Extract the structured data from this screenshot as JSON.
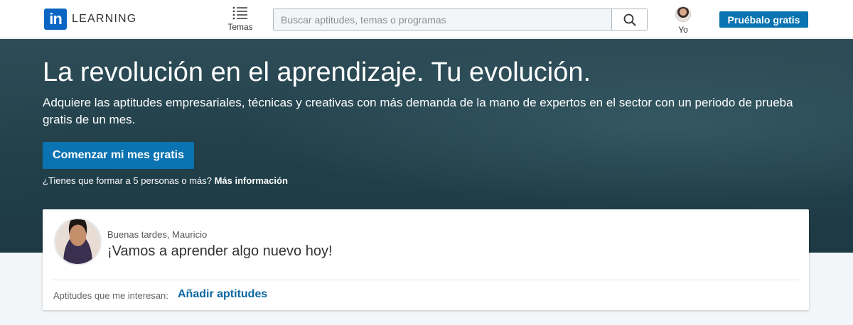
{
  "header": {
    "logo_mark": "in",
    "logo_text": "LEARNING",
    "topics_label": "Temas",
    "search_placeholder": "Buscar aptitudes, temas o programas",
    "me_label": "Yo",
    "try_button": "Pruébalo gratis"
  },
  "hero": {
    "title": "La revolución en el aprendizaje. Tu evolución.",
    "subtitle": "Adquiere las aptitudes empresariales, técnicas y creativas con más demanda de la mano de expertos en el sector con un periodo de prueba gratis de un mes.",
    "cta": "Comenzar mi mes gratis",
    "note": "¿Tienes que formar a 5 personas o más?",
    "note_link": "Más información"
  },
  "welcome": {
    "greeting": "Buenas tardes, Mauricio",
    "motto": "¡Vamos a aprender algo nuevo hoy!",
    "skills_label": "Aptitudes que me interesan:",
    "skills_link": "Añadir aptitudes"
  },
  "colors": {
    "brand_blue": "#0a66c2",
    "button_blue": "#0a73b1",
    "hero_bg": "#22414b"
  }
}
